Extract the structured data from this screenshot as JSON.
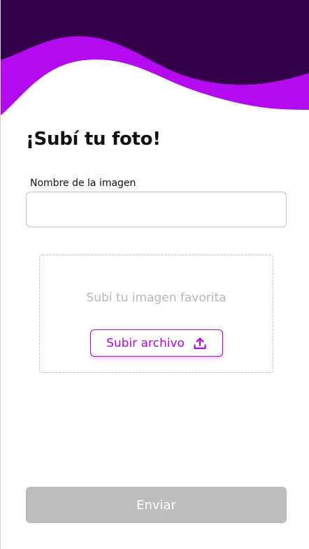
{
  "header": {
    "title": "¡Subí tu foto!"
  },
  "form": {
    "name_label": "Nombre de la imagen",
    "name_value": "",
    "name_placeholder": ""
  },
  "upload": {
    "hint": "Subí tu imagen favorita",
    "button_label": "Subir archivo",
    "button_icon": "upload-icon"
  },
  "submit": {
    "label": "Enviar"
  },
  "colors": {
    "wave_dark": "#34004a",
    "wave_accent": "#b30af0",
    "accent": "#b208e4",
    "disabled_button": "#bdbdbd",
    "hint_text": "#b7b7b7"
  }
}
